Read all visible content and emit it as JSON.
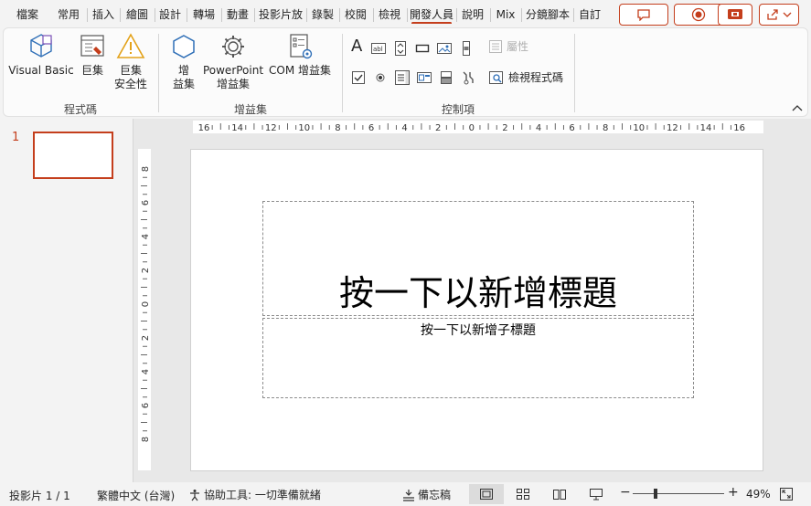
{
  "tabs": [
    "檔案",
    "常用",
    "插入",
    "繪圖",
    "設計",
    "轉場",
    "動畫",
    "投影片放",
    "錄製",
    "校閱",
    "檢視",
    "開發人員",
    "說明",
    "Mix",
    "分鏡腳本",
    "自訂"
  ],
  "active_tab_index": 11,
  "ribbon": {
    "code_group": {
      "label": "程式碼",
      "visual_basic": "Visual Basic",
      "macros": "巨集",
      "macro_security_1": "巨集",
      "macro_security_2": "安全性"
    },
    "addins_group": {
      "label": "增益集",
      "addins_1": "增",
      "addins_2": "益集",
      "ppt_addins_1": "PowerPoint",
      "ppt_addins_2": "增益集",
      "com_addins": "COM 增益集"
    },
    "controls_group": {
      "label": "控制項",
      "properties": "屬性",
      "view_code": "檢視程式碼"
    }
  },
  "slides": {
    "current_number": "1"
  },
  "rulers": {
    "horizontal": [
      "16",
      "14",
      "12",
      "10",
      "8",
      "6",
      "4",
      "2",
      "0",
      "2",
      "4",
      "6",
      "8",
      "10",
      "12",
      "14",
      "16"
    ],
    "vertical": [
      "8",
      "6",
      "4",
      "2",
      "0",
      "2",
      "4",
      "6",
      "8"
    ]
  },
  "slide": {
    "title_placeholder": "按一下以新增標題",
    "subtitle_placeholder": "按一下以新增子標題"
  },
  "statusbar": {
    "slide_count": "投影片 1 / 1",
    "language": "繁體中文 (台灣)",
    "accessibility": "協助工具: 一切準備就緒",
    "notes": "備忘稿",
    "zoom_minus": "−",
    "zoom_plus": "+",
    "zoom": "49%",
    "zoom_fraction": 0.49
  },
  "colors": {
    "accent": "#c43e1c",
    "icon_blue": "#2f6fb7",
    "icon_gold": "#e3a21a"
  }
}
